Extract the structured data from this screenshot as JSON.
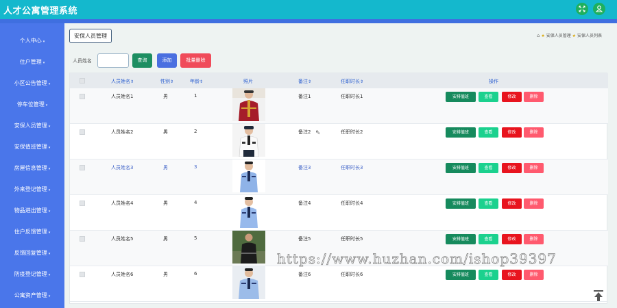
{
  "header": {
    "title": "人才公寓管理系统",
    "icons": [
      "fullscreen-icon",
      "user-icon"
    ]
  },
  "sidebar": {
    "items": [
      {
        "label": "个人中心"
      },
      {
        "label": "住户管理"
      },
      {
        "label": "小区公告管理"
      },
      {
        "label": "停车位管理"
      },
      {
        "label": "安保人员管理"
      },
      {
        "label": "安保值班管理"
      },
      {
        "label": "房屋信息管理"
      },
      {
        "label": "外来登记管理"
      },
      {
        "label": "物品进出管理"
      },
      {
        "label": "住户反馈管理"
      },
      {
        "label": "反馈回复管理"
      },
      {
        "label": "防疫登记管理"
      },
      {
        "label": "公寓资产管理"
      }
    ]
  },
  "main": {
    "tab_label": "安保人员管理",
    "breadcrumb": [
      "安保人员管理",
      "安保人员列表"
    ]
  },
  "search": {
    "label": "人员姓名",
    "value": "",
    "query_label": "查询",
    "add_label": "添加",
    "batch_delete_label": "批量删除"
  },
  "table": {
    "headers": {
      "name": "人员姓名",
      "gender": "性别",
      "age": "年龄",
      "photo": "照片",
      "remark": "备注",
      "tenure": "任职时长",
      "actions": "操作"
    },
    "action_labels": {
      "schedule": "安排值班",
      "view": "查看",
      "edit": "修改",
      "delete": "删除"
    },
    "rows": [
      {
        "name": "人员姓名1",
        "gender": "男",
        "age": "1",
        "remark": "备注1",
        "tenure": "任职时长1"
      },
      {
        "name": "人员姓名2",
        "gender": "男",
        "age": "2",
        "remark": "备注2",
        "tenure": "任职时长2"
      },
      {
        "name": "人员姓名3",
        "gender": "男",
        "age": "3",
        "remark": "备注3",
        "tenure": "任职时长3"
      },
      {
        "name": "人员姓名4",
        "gender": "男",
        "age": "4",
        "remark": "备注4",
        "tenure": "任职时长4"
      },
      {
        "name": "人员姓名5",
        "gender": "男",
        "age": "5",
        "remark": "备注5",
        "tenure": "任职时长5"
      },
      {
        "name": "人员姓名6",
        "gender": "男",
        "age": "6",
        "remark": "备注6",
        "tenure": "任职时长6"
      }
    ]
  },
  "watermark": "https://www.huzhan.com/ishop39397",
  "colors": {
    "topbar": "#14b8cd",
    "sidebar": "#4a76ea",
    "query_button": "#1d8e62",
    "add_button": "#4a6fe0",
    "batch_delete_button": "#f04b5a",
    "schedule_button": "#168a5d",
    "view_button": "#1bd18e",
    "edit_button": "#e8141e",
    "delete_button": "#ff5a6e"
  }
}
